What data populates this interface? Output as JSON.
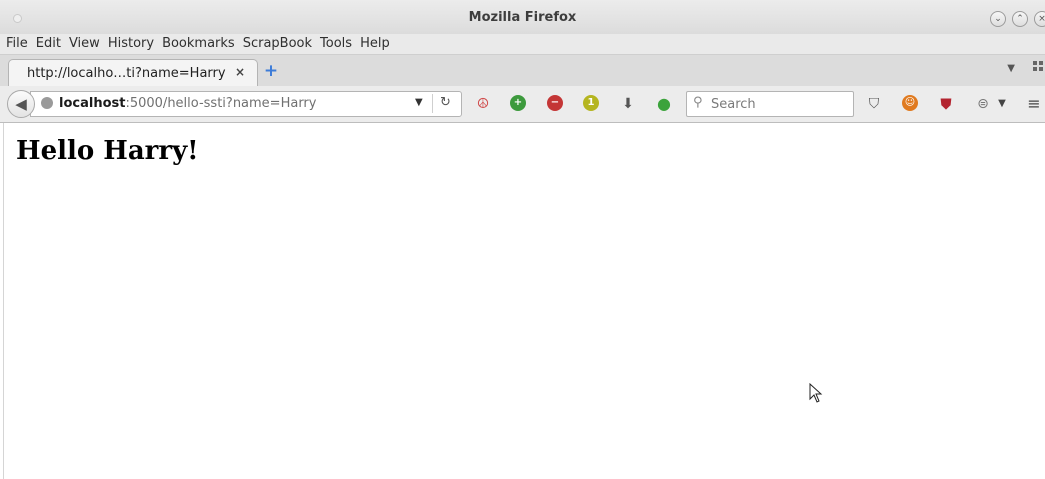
{
  "window": {
    "title": "Mozilla Firefox"
  },
  "menu": {
    "items": [
      "File",
      "Edit",
      "View",
      "History",
      "Bookmarks",
      "ScrapBook",
      "Tools",
      "Help"
    ]
  },
  "tab": {
    "title": "http://localho…ti?name=Harry",
    "close": "×",
    "new_tab": "+"
  },
  "url": {
    "host": "localhost",
    "rest": ":5000/hello-ssti?name=Harry"
  },
  "search": {
    "placeholder": "Search"
  },
  "page": {
    "heading": "Hello Harry!"
  },
  "icons": {
    "window_controls": [
      "minimize-icon",
      "maximize-icon",
      "close-icon"
    ],
    "toolbar": [
      "peace-icon",
      "zoom-in-icon",
      "zoom-out-icon",
      "zoom-reset-icon",
      "download-icon",
      "green-dot-icon",
      "pocket-icon",
      "extension-icon",
      "ublock-icon",
      "layers-icon",
      "menu-icon"
    ]
  },
  "colors": {
    "accent": "#3d7cd8"
  }
}
